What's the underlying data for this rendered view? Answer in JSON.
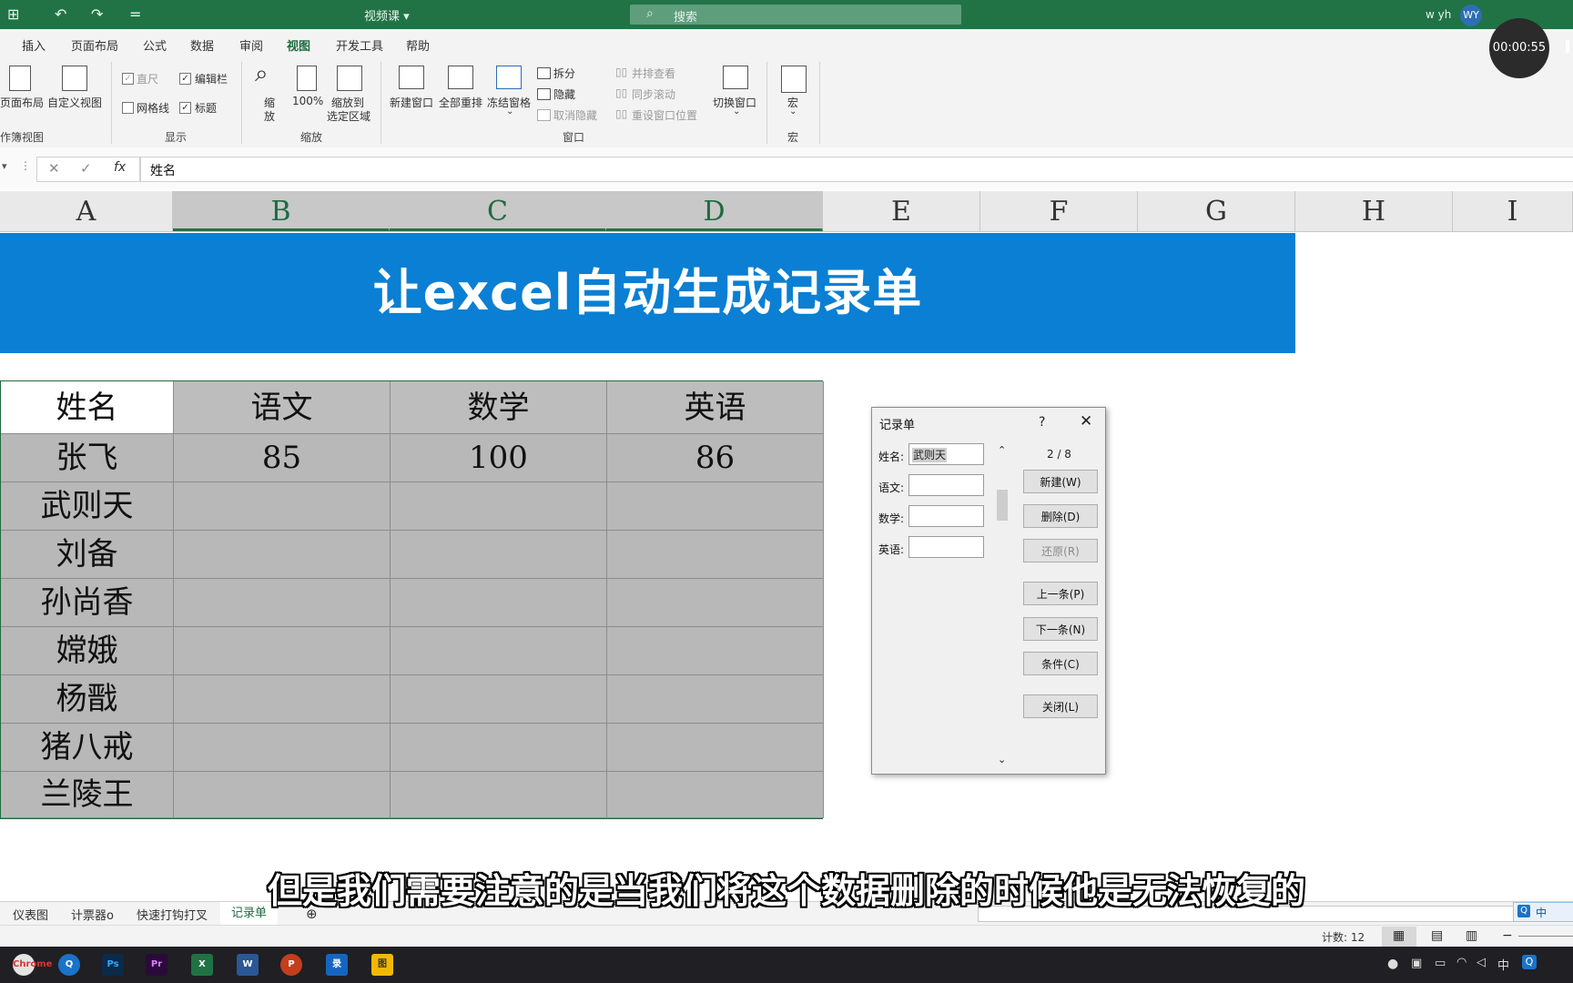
{
  "window": {
    "quick_access": [
      "⊞",
      "↶",
      "↷",
      "="
    ],
    "title": "视频课 ▾",
    "search_placeholder": "搜索",
    "user_name": "w yh",
    "user_initials": "WY"
  },
  "recorder": {
    "time": "00:00:55"
  },
  "menu_tabs": [
    "插入",
    "页面布局",
    "公式",
    "数据",
    "审阅",
    "视图",
    "开发工具",
    "帮助"
  ],
  "active_tab": "视图",
  "ribbon": {
    "workbook_views": {
      "page_layout": "页面布局",
      "custom_views": "自定义视图",
      "group": "作簿视图"
    },
    "show": {
      "ruler": "直尺",
      "formula_bar": "编辑栏",
      "gridlines": "网格线",
      "headings": "标题",
      "group": "显示"
    },
    "zoom": {
      "zoom_line1": "缩",
      "zoom_line2": "放",
      "zoom100": "100%",
      "zoom_sel_line1": "缩放到",
      "zoom_sel_line2": "选定区域",
      "group": "缩放"
    },
    "window": {
      "new_window": "新建窗口",
      "arrange_all": "全部重排",
      "freeze_panes": "冻结窗格",
      "split": "拆分",
      "hide": "隐藏",
      "unhide": "取消隐藏",
      "side_by_side": "并排查看",
      "sync_scroll": "同步滚动",
      "reset_position": "重设窗口位置",
      "switch_windows": "切换窗口",
      "group": "窗口"
    },
    "macros": {
      "macros": "宏",
      "group": "宏"
    }
  },
  "formula_bar": {
    "content": "姓名"
  },
  "columns": [
    "A",
    "B",
    "C",
    "D",
    "E",
    "F",
    "G",
    "H",
    "I"
  ],
  "banner": {
    "title": "让excel自动生成记录单"
  },
  "table": {
    "headers": [
      "姓名",
      "语文",
      "数学",
      "英语"
    ],
    "rows": [
      [
        "张飞",
        "85",
        "100",
        "86"
      ],
      [
        "武则天",
        "",
        "",
        ""
      ],
      [
        "刘备",
        "",
        "",
        ""
      ],
      [
        "孙尚香",
        "",
        "",
        ""
      ],
      [
        "嫦娥",
        "",
        "",
        ""
      ],
      [
        "杨戬",
        "",
        "",
        ""
      ],
      [
        "猪八戒",
        "",
        "",
        ""
      ],
      [
        "兰陵王",
        "",
        "",
        ""
      ]
    ]
  },
  "dialog": {
    "title": "记录单",
    "help": "?",
    "close_glyph": "✕",
    "record_counter": "2 / 8",
    "fields": [
      {
        "label": "姓名:",
        "value": "武则天"
      },
      {
        "label": "语文:",
        "value": ""
      },
      {
        "label": "数学:",
        "value": ""
      },
      {
        "label": "英语:",
        "value": ""
      }
    ],
    "buttons": {
      "new": "新建(W)",
      "delete": "删除(D)",
      "restore": "还原(R)",
      "prev": "上一条(P)",
      "next": "下一条(N)",
      "criteria": "条件(C)",
      "close": "关闭(L)"
    }
  },
  "sheets": [
    "仪表图",
    "计票器o",
    "快速打钩打叉",
    "记录单"
  ],
  "active_sheet": "记录单",
  "subtitle": "但是我们需要注意的是当我们将这个数据删除的时候他是无法恢复的",
  "status": {
    "count": "计数: 12"
  },
  "ime": {
    "label": "中"
  },
  "taskbar": {
    "apps": [
      "Chrome",
      "Q",
      "Ps",
      "Pr",
      "X",
      "W",
      "P",
      "录",
      "图"
    ],
    "ime_label": "中"
  }
}
